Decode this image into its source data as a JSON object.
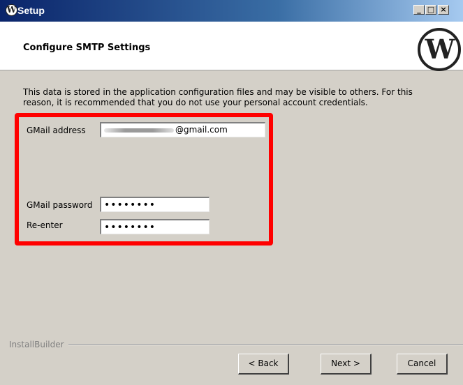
{
  "window": {
    "title": "Setup",
    "minimize_glyph": "_",
    "maximize_glyph": "□",
    "close_glyph": "×",
    "icon": "wordpress-icon"
  },
  "header": {
    "title": "Configure SMTP Settings",
    "logo": "wordpress-logo",
    "logo_glyph": "W"
  },
  "description": "This data is stored in the application configuration files and may be visible to others. For this reason, it is recommended that you do not use your personal account credentials.",
  "form": {
    "email_label": "GMail address",
    "email_value": "@gmail.com",
    "password_label": "GMail password",
    "password_value": "••••••••",
    "reenter_label": "Re-enter",
    "reenter_value": "••••••••",
    "highlight_color": "#ff0000"
  },
  "footer": {
    "brand": "InstallBuilder",
    "back_label": "< Back",
    "next_label": "Next >",
    "cancel_label": "Cancel"
  }
}
